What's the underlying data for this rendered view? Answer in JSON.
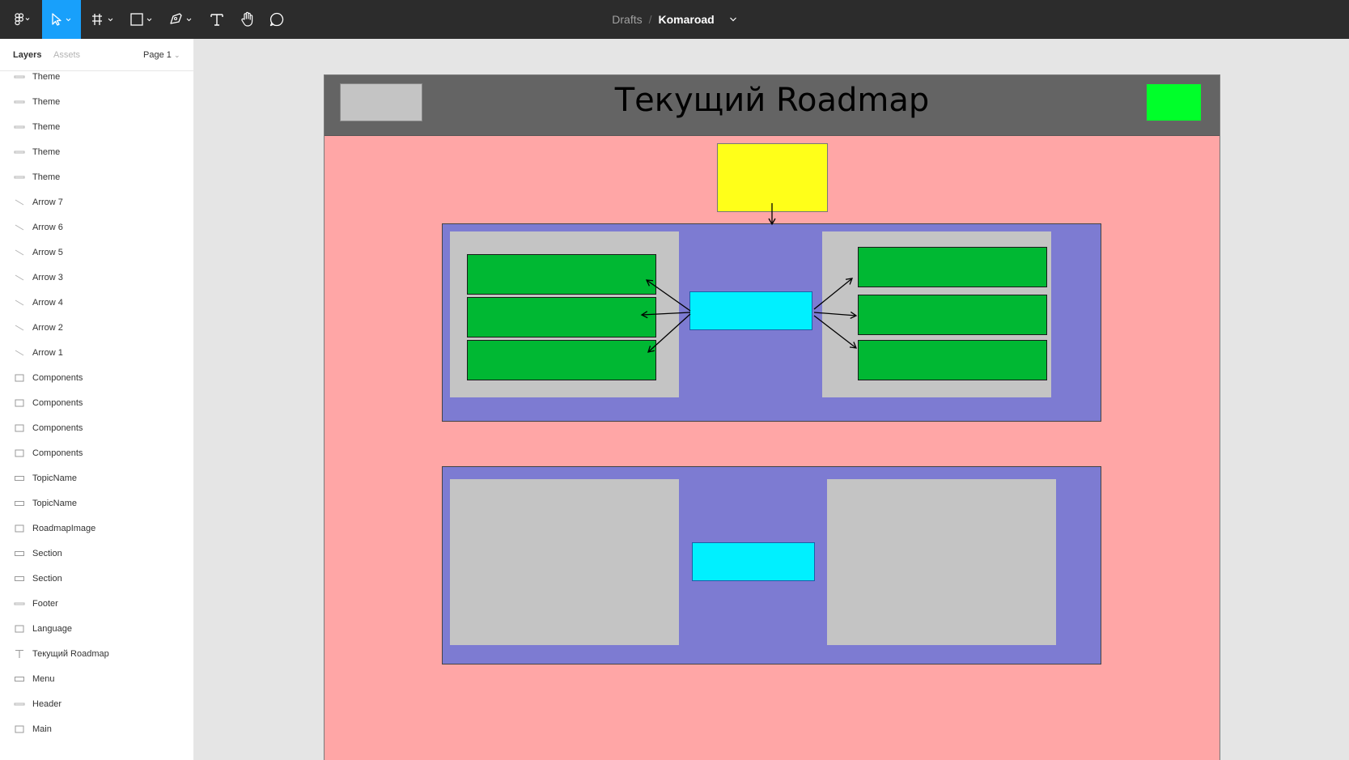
{
  "toolbar": {
    "tools": [
      "figma-menu-icon",
      "move-tool-icon",
      "frame-tool-icon",
      "shape-tool-icon",
      "pen-tool-icon",
      "text-tool-icon",
      "hand-tool-icon",
      "comment-tool-icon"
    ],
    "active_tool": "move-tool-icon",
    "breadcrumb": {
      "folder": "Drafts",
      "separator": "/",
      "file": "Komaroad"
    }
  },
  "panel": {
    "tab_layers": "Layers",
    "tab_assets": "Assets",
    "page": "Page 1"
  },
  "layers": [
    {
      "label": "Theme",
      "icon": "line-icon"
    },
    {
      "label": "Theme",
      "icon": "line-icon"
    },
    {
      "label": "Theme",
      "icon": "line-icon"
    },
    {
      "label": "Theme",
      "icon": "line-icon"
    },
    {
      "label": "Theme",
      "icon": "line-icon"
    },
    {
      "label": "Arrow 7",
      "icon": "arrow-line-icon"
    },
    {
      "label": "Arrow 6",
      "icon": "arrow-line-icon"
    },
    {
      "label": "Arrow 5",
      "icon": "arrow-line-icon"
    },
    {
      "label": "Arrow 3",
      "icon": "arrow-line-icon"
    },
    {
      "label": "Arrow 4",
      "icon": "arrow-line-icon"
    },
    {
      "label": "Arrow 2",
      "icon": "arrow-line-icon"
    },
    {
      "label": "Arrow 1",
      "icon": "arrow-line-icon"
    },
    {
      "label": "Components",
      "icon": "rectangle-icon"
    },
    {
      "label": "Components",
      "icon": "rectangle-icon"
    },
    {
      "label": "Components",
      "icon": "rectangle-icon"
    },
    {
      "label": "Components",
      "icon": "rectangle-icon"
    },
    {
      "label": "TopicName",
      "icon": "flat-rectangle-icon"
    },
    {
      "label": "TopicName",
      "icon": "flat-rectangle-icon"
    },
    {
      "label": "RoadmapImage",
      "icon": "rectangle-icon"
    },
    {
      "label": "Section",
      "icon": "flat-rectangle-icon"
    },
    {
      "label": "Section",
      "icon": "flat-rectangle-icon"
    },
    {
      "label": "Footer",
      "icon": "line-icon"
    },
    {
      "label": "Language",
      "icon": "rectangle-icon"
    },
    {
      "label": "Текущий Roadmap",
      "icon": "text-icon"
    },
    {
      "label": "Menu",
      "icon": "flat-rectangle-icon"
    },
    {
      "label": "Header",
      "icon": "line-icon"
    },
    {
      "label": "Main",
      "icon": "rectangle-icon"
    }
  ],
  "canvas": {
    "header_title": "Текущий Roadmap",
    "colors": {
      "frame_bg": "#ffa6a6",
      "header_bg": "#646464",
      "logo": "#c4c4c4",
      "language": "#00ff2a",
      "topic": "#ffff19",
      "section_bg": "#7d7bd2",
      "panel": "#c4c4c4",
      "component": "#00b833",
      "roadmap_image": "#00f0ff"
    }
  }
}
